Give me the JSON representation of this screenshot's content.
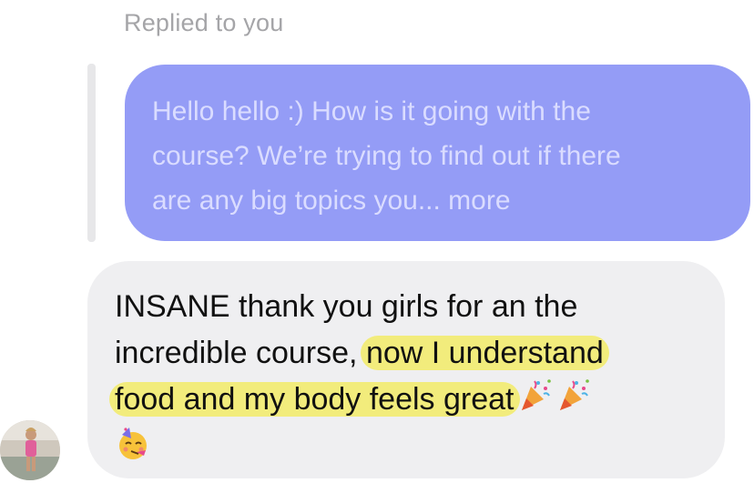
{
  "reply_label": "Replied to you",
  "quoted_message": {
    "lines": [
      "Hello hello :) How is it going with the",
      "course? We’re trying to find out if there",
      "are any big topics you... more"
    ]
  },
  "reply_message": {
    "line1": "INSANE thank you girls for an the",
    "line2_plain": "incredible course,",
    "line2_highlight": "now I understand",
    "line3_highlight": "food and my body feels great",
    "highlight_color": "#f2ec7c"
  },
  "icons": {
    "party_popper_1": "party-popper-icon",
    "party_popper_2": "party-popper-icon",
    "partying_face": "partying-face-icon",
    "avatar": "profile-avatar"
  },
  "colors": {
    "quoted_bubble": "#949cf6",
    "quoted_text": "#dadcff",
    "reply_bubble": "#efeff1",
    "reply_text": "#111111",
    "label": "#a5a5a8"
  }
}
